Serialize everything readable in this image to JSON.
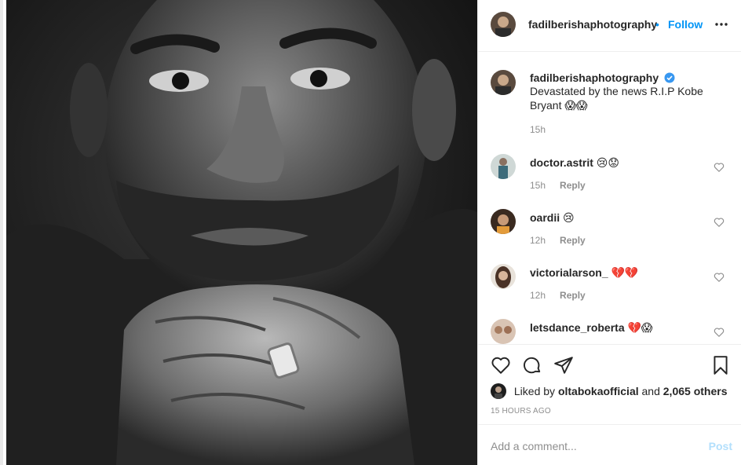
{
  "post": {
    "username": "fadilberishaphotography",
    "separator": "•",
    "follow_label": "Follow",
    "caption_username": "fadilberishaphotography",
    "caption_text": "Devastated by the news R.I.P Kobe Bryant 😱😱",
    "caption_time": "15h"
  },
  "comments": [
    {
      "username": "doctor.astrit",
      "text": "😢😟",
      "time": "15h",
      "reply": "Reply"
    },
    {
      "username": "oardii",
      "text": "😢",
      "time": "12h",
      "reply": "Reply"
    },
    {
      "username": "victorialarson_",
      "text": "💔💔",
      "time": "12h",
      "reply": "Reply"
    },
    {
      "username": "letsdance_roberta",
      "text": "💔😱",
      "time": "",
      "reply": ""
    }
  ],
  "likes": {
    "prefix": "Liked by",
    "user": "oltabokaofficial",
    "middle": "and",
    "others": "2,065 others"
  },
  "timestamp": "15 HOURS AGO",
  "add_comment": {
    "placeholder": "Add a comment...",
    "post_label": "Post"
  },
  "icons": {
    "like": "heart-icon",
    "comment": "comment-icon",
    "share": "share-icon",
    "save": "bookmark-icon",
    "more": "more-options-icon",
    "verified": "verified-badge-icon"
  },
  "colors": {
    "accent": "#0095f6",
    "muted": "#8e8e8e",
    "post_disabled": "#b2dffc",
    "border": "#efefef"
  }
}
